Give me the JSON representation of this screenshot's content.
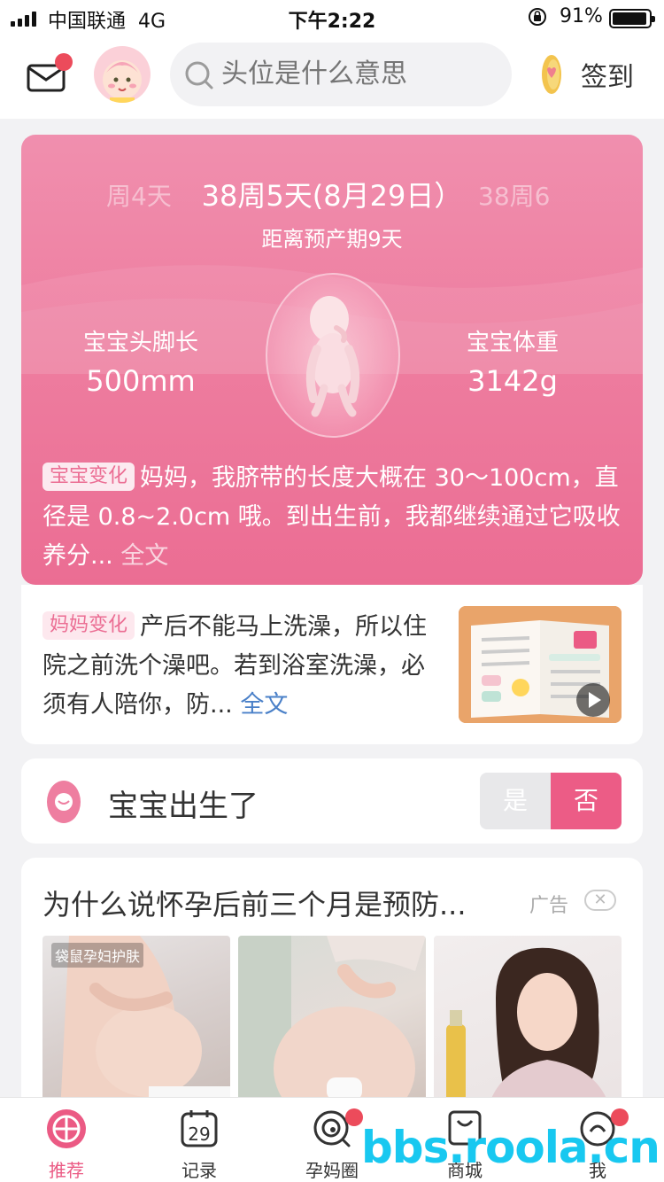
{
  "status_bar": {
    "carrier": "中国联通",
    "network": "4G",
    "time": "下午2:22",
    "battery": "91%"
  },
  "header": {
    "search_placeholder": "头位是什么意思",
    "checkin_label": "签到"
  },
  "pregnancy": {
    "week_prev": "周4天",
    "week_current": "38周5天(8月29日）",
    "week_next": "38周6",
    "due_countdown": "距离预产期9天",
    "stat_left_label": "宝宝头脚长",
    "stat_left_value": "500mm",
    "stat_right_label": "宝宝体重",
    "stat_right_value": "3142g",
    "change_tag": "宝宝变化",
    "change_text": "妈妈，我脐带的长度大概在 30～100cm，直径是 0.8~2.0cm 哦。到出生前，我都继续通过它吸收养分...",
    "change_more": "全文"
  },
  "mom": {
    "tag": "妈妈变化",
    "text": "产后不能马上洗澡，所以住院之前洗个澡吧。若到浴室洗澡，必须有人陪你，防...",
    "more": "全文"
  },
  "birth": {
    "label": "宝宝出生了",
    "yes": "是",
    "no": "否"
  },
  "ad": {
    "title": "为什么说怀孕后前三个月是预防...",
    "label": "广告",
    "close": "✕",
    "image1_tag": "袋鼠孕妇护肤"
  },
  "tabs": [
    {
      "label": "推荐",
      "icon": "home-icon",
      "active": true
    },
    {
      "label": "记录",
      "icon": "calendar-icon",
      "active": false
    },
    {
      "label": "孕妈圈",
      "icon": "community-icon",
      "active": false
    },
    {
      "label": "商城",
      "icon": "shopping-bag-icon",
      "active": false
    },
    {
      "label": "我",
      "icon": "profile-icon",
      "active": false
    }
  ],
  "calendar_day": "29",
  "watermark": "bbs.roola.cn",
  "colors": {
    "accent": "#eb6d93",
    "badge": "#ec4b5b",
    "link": "#4a80c8"
  }
}
